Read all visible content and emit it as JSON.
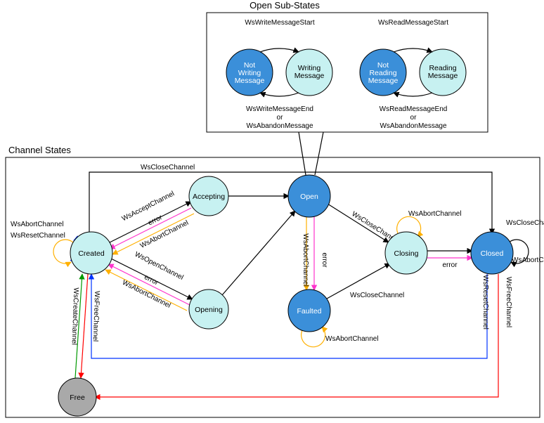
{
  "titles": {
    "open_sub": "Open Sub-States",
    "channel_states": "Channel States"
  },
  "sub": {
    "write": {
      "idle_l1": "Not",
      "idle_l2": "Writing",
      "idle_l3": "Message",
      "active_l1": "Writing",
      "active_l2": "Message",
      "enter": "WsWriteMessageStart",
      "exit_l1": "WsWriteMessageEnd",
      "exit_l2": "or",
      "exit_l3": "WsAbandonMessage"
    },
    "read": {
      "idle_l1": "Not",
      "idle_l2": "Reading",
      "idle_l3": "Message",
      "active_l1": "Reading",
      "active_l2": "Message",
      "enter": "WsReadMessageStart",
      "exit_l1": "WsReadMessageEnd",
      "exit_l2": "or",
      "exit_l3": "WsAbandonMessage"
    }
  },
  "nodes": {
    "created": "Created",
    "accepting": "Accepting",
    "opening": "Opening",
    "open": "Open",
    "faulted": "Faulted",
    "closing": "Closing",
    "closed": "Closed",
    "free": "Free"
  },
  "edges": {
    "close_top": "WsCloseChannel",
    "accept": "WsAcceptChannel",
    "accept_err": "error",
    "accept_abort": "WsAbortChannel",
    "open": "WsOpenChannel",
    "open_err": "error",
    "open_abort": "WsAbortChannel",
    "open_close": "WsCloseChannel",
    "open_abort_down": "WsAbortChannel",
    "open_error_down": "error",
    "faulted_close": "WsCloseChannel",
    "faulted_loop": "WsAbortChannel",
    "closing_loop": "WsAbortChannel",
    "closing_err": "error",
    "closed_close_loop": "WsCloseChannel",
    "closed_abort_loop": "WsAbortChannel",
    "closed_reset": "WsResetChannel",
    "closed_free": "WsFreeChannel",
    "created_abort_loop": "WsAbortChannel",
    "created_reset_loop": "WsResetChannel",
    "created_free": "WsFreeChannel",
    "create": "WsCreateChannel"
  }
}
